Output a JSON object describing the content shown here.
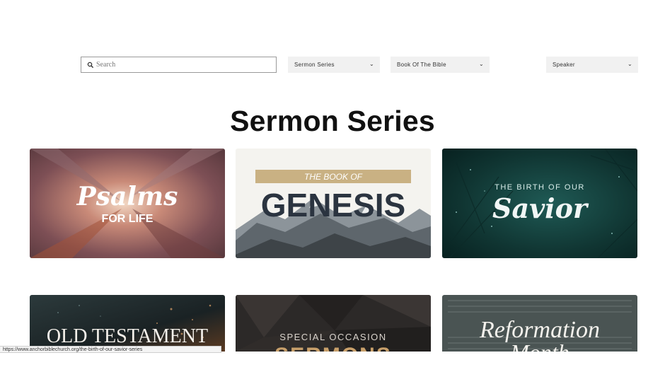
{
  "filters": {
    "search_placeholder": "Search",
    "dropdowns": [
      {
        "label": "Sermon Series"
      },
      {
        "label": "Book Of The Bible"
      },
      {
        "label": "Speaker"
      }
    ]
  },
  "page_title": "Sermon Series",
  "series_cards": [
    {
      "title_script": "Psalms",
      "subtitle": "FOR LIFE"
    },
    {
      "title_small": "THE BOOK OF",
      "title": "GENESIS"
    },
    {
      "title_small": "THE BIRTH OF OUR",
      "title_script": "Savior"
    },
    {
      "title": "OLD TESTAMENT"
    },
    {
      "title_small": "SPECIAL OCCASION",
      "title": "SERMONS"
    },
    {
      "title_script": "Reformation",
      "subtitle": "Month"
    }
  ],
  "status_bar": {
    "url": "https://www.anchorbiblechurch.org/the-birth-of-our-savior-series"
  }
}
